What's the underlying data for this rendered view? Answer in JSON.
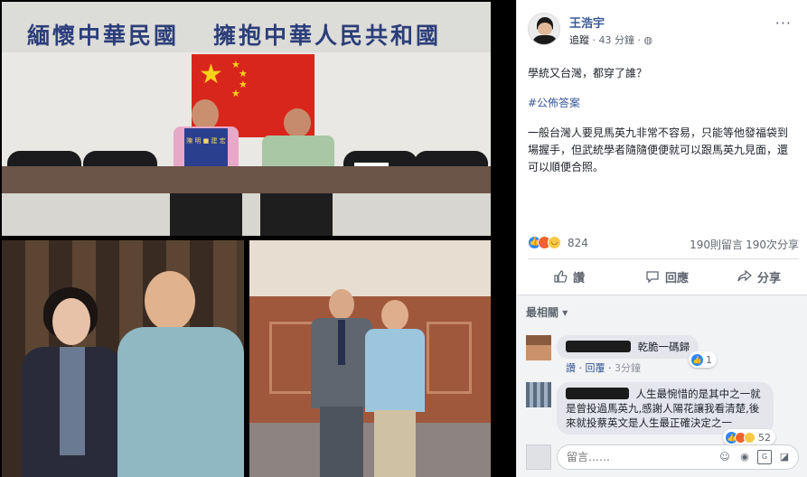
{
  "photos": {
    "top_banner_left": "緬懷中華民國",
    "top_banner_right": "擁抱中華人民共和國",
    "vest_text": "陳 明 ■ 建 宏"
  },
  "post": {
    "author": "王浩宇",
    "follow_label": "追蹤",
    "time": "43 分鐘",
    "privacy_icon": "globe-icon",
    "body_question": "學統又台灣，都穿了誰？",
    "hashtag": "#公佈答案",
    "body_main": "一般台灣人要見馬英九非常不容易，只能等他發福袋到場握手，但武統學者隨隨便便就可以跟馬英九見面，還可以順便合照。"
  },
  "stats": {
    "reaction_count": "824",
    "comment_count": "190則留言",
    "share_count": "190次分享"
  },
  "actions": {
    "like": "讚",
    "comment": "回應",
    "share": "分享"
  },
  "comments": {
    "sort_label": "最相關",
    "c1": {
      "text": "乾脆一碼歸",
      "like": "讚",
      "reply": "回覆",
      "time": "3分鐘",
      "reactions": "1"
    },
    "c2": {
      "text": "人生最惋惜的是其中之一就是曾投過馬英九,感謝人陽花讓我看清楚,後來就投蔡英文是人生最正確決定之一",
      "reactions": "52"
    },
    "composer_placeholder": "留言……"
  },
  "colors": {
    "link": "#385898",
    "like_blue": "#2d88ff",
    "flag_red": "#d9261c"
  }
}
